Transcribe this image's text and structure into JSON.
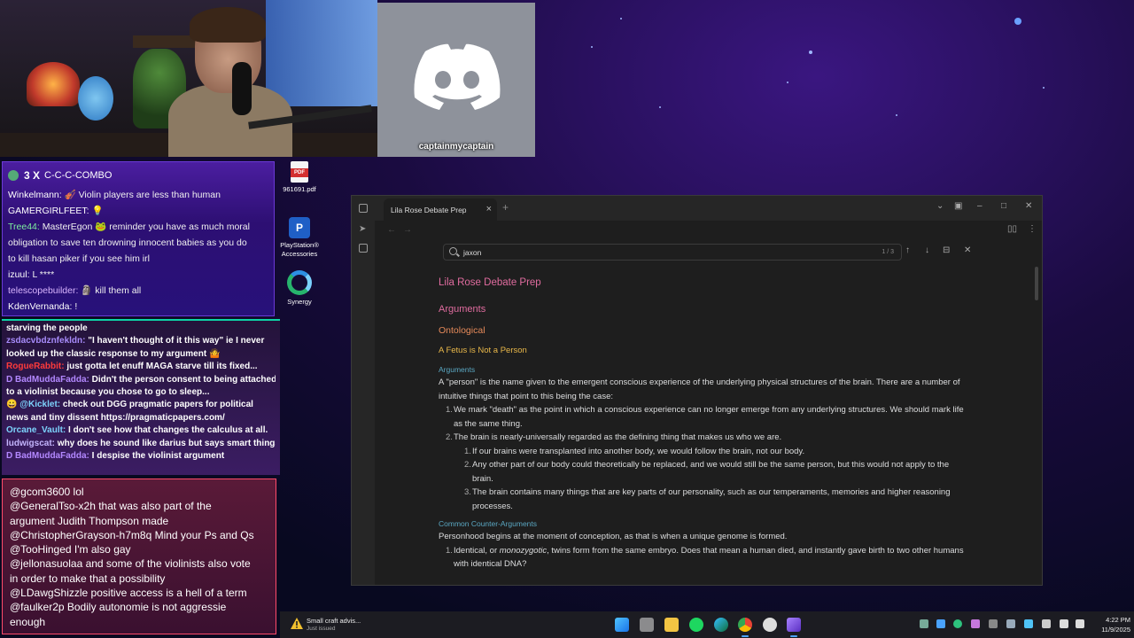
{
  "discord": {
    "username": "captainmycaptain"
  },
  "chat_top": {
    "combo_count": "3 X",
    "combo_label": "C-C-C-COMBO",
    "messages": [
      {
        "user": "Winkelmann:",
        "text": "🎻 Violin players are less than human"
      },
      {
        "user": "GAMERGIRLFEET:",
        "text": "💡"
      },
      {
        "user": "Tree44:",
        "text": "MasterEgon 🐸 reminder you have as much moral"
      },
      {
        "user": "",
        "text": "obligation to save ten drowning innocent babies as you do"
      },
      {
        "user": "",
        "text": "to kill hasan piker if you see him irl"
      },
      {
        "user": "izuul:",
        "text": "L ****"
      },
      {
        "user": "telescopebuilder:",
        "text": "🗿 kill them all"
      },
      {
        "user": "KdenVernanda:",
        "text": "!"
      }
    ]
  },
  "chat_mid": {
    "messages": [
      {
        "user": "",
        "text": "starving the people",
        "ucolor": "#ffffff"
      },
      {
        "user": "zsdacvbdznfekldn:",
        "text": "\"I haven't thought of it this way\" ie I never",
        "ucolor": "#a78bfa"
      },
      {
        "user": "",
        "text": "looked up the classic response to my argument 🤷",
        "ucolor": "#ffffff"
      },
      {
        "user": "RogueRabbit:",
        "text": "just gotta let enuff MAGA starve till its fixed...",
        "ucolor": "#ff3b3b"
      },
      {
        "user": "D BadMuddaFadda:",
        "text": "Didn't the person consent to being attached",
        "ucolor": "#b388ff"
      },
      {
        "user": "",
        "text": "to a violinist because you chose to go to sleep...",
        "ucolor": "#ffffff"
      },
      {
        "user": "😀 @Kicklet:",
        "text": "check out DGG pragmatic papers for political",
        "ucolor": "#7dd3fc"
      },
      {
        "user": "",
        "text": "news and tiny dissent https://pragmaticpapers.com/",
        "ucolor": "#ffffff"
      },
      {
        "user": "Orcane_Vault:",
        "text": "I don't see how that changes the calculus at all.",
        "ucolor": "#7dd3fc"
      },
      {
        "user": "ludwigscat:",
        "text": "why does he sound like darius but says smart things",
        "ucolor": "#c4b5fd"
      },
      {
        "user": "D BadMuddaFadda:",
        "text": "I despise the violinist argument",
        "ucolor": "#b388ff"
      }
    ]
  },
  "chat_bottom": {
    "messages": [
      {
        "text": "@gcom3600 lol"
      },
      {
        "text": "@GeneralTso-x2h that was also part of the"
      },
      {
        "text": "argument Judith Thompson made"
      },
      {
        "text": "@ChristopherGrayson-h7m8q Mind your Ps and Qs"
      },
      {
        "text": "@TooHinged I'm also gay"
      },
      {
        "text": "@jellonasuolaa and some of the violinists also vote"
      },
      {
        "text": "in order to make that a possibility"
      },
      {
        "text": "@LDawgShizzle positive access is a hell of a term"
      },
      {
        "text": "@faulker2p Bodily autonomie is not aggressie"
      },
      {
        "text": "enough"
      }
    ]
  },
  "desktop_icons": [
    {
      "label": "961691.pdf",
      "icon": "pdf-icon"
    },
    {
      "label": "PlayStation® Accessories",
      "icon": "playstation-icon"
    },
    {
      "label": "Synergy",
      "icon": "synergy-icon"
    }
  ],
  "obsidian": {
    "tab_title": "Lila Rose Debate Prep",
    "search": {
      "value": "jaxon",
      "count": "1 / 3"
    },
    "note": {
      "title": "Lila Rose Debate Prep",
      "h_arguments": "Arguments",
      "h_ontological": "Ontological",
      "h_fetus": "A Fetus is Not a Person",
      "h_arguments_small": "Arguments",
      "para1": "A \"person\" is the name given to the emergent conscious experience of the underlying physical structures of the brain. There are a number of intuitive things that point to this being the case:",
      "list1": [
        {
          "n": "1.",
          "text": "We mark \"death\" as the point in which a conscious experience can no longer emerge from any underlying structures. We should mark life as the same thing."
        },
        {
          "n": "2.",
          "text": "The brain is nearly-universally regarded as the defining thing that makes us who we are."
        }
      ],
      "list2": [
        {
          "n": "1.",
          "text": "If our brains were transplanted into another body, we would follow the brain, not our body."
        },
        {
          "n": "2.",
          "text": "Any other part of our body could theoretically be replaced, and we would still be the same person, but this would not apply to the brain."
        },
        {
          "n": "3.",
          "text": "The brain contains many things that are key parts of our personality, such as our temperaments, memories and higher reasoning processes."
        }
      ],
      "h_counter": "Common Counter-Arguments",
      "para2": "Personhood begins at the moment of conception, as that is when a unique genome is formed.",
      "list3_n": "1.",
      "list3_a": "Identical, or ",
      "list3_em": "monozygotic",
      "list3_b": ", twins form from the same embryo. Does that mean a human died, and instantly gave birth to two other humans with identical DNA?"
    }
  },
  "taskbar": {
    "news_title": "Small craft advis...",
    "news_sub": "Just issued",
    "time": "4:22 PM",
    "date": "11/9/2025"
  },
  "colors": {
    "accent": "#e06c9f",
    "chat_border": "#0dd3a6",
    "taskbar": "#1c1c22"
  }
}
